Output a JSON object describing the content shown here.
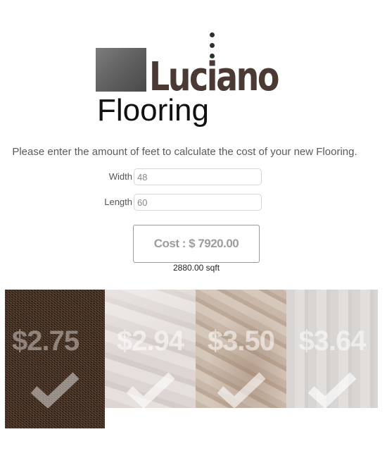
{
  "logo": {
    "brand_line1": "Luciano",
    "brand_line2": "Flooring",
    "colors": {
      "square": "#666666",
      "luciano": "#4a3a33",
      "flooring": "#111111"
    }
  },
  "instructions": "Please enter the amount of feet to calculate the cost of your new Flooring.",
  "form": {
    "width_label": "Width",
    "width_value": "48",
    "length_label": "Length",
    "length_value": "60"
  },
  "result": {
    "cost_text": "Cost : $ 7920.00",
    "area_text": "2880.00 sqft"
  },
  "flooring_options": [
    {
      "price": "$2.75",
      "selected": true,
      "icon": "checkmark-icon",
      "color": "#4a3426"
    },
    {
      "price": "$2.94",
      "selected": false,
      "icon": "checkmark-icon",
      "color": "#ddd6d2"
    },
    {
      "price": "$3.50",
      "selected": false,
      "icon": "checkmark-icon",
      "color": "#cdbcae"
    },
    {
      "price": "$3.64",
      "selected": false,
      "icon": "checkmark-icon",
      "color": "#dad7d5"
    }
  ]
}
